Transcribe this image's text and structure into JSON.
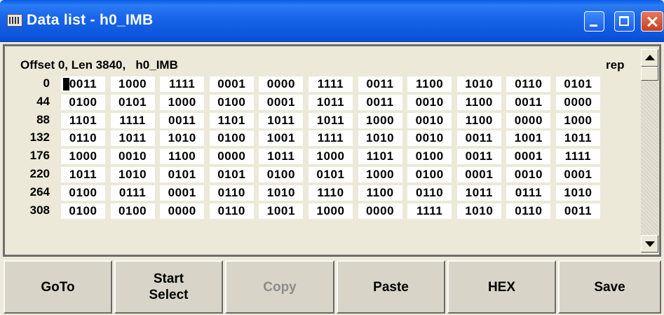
{
  "window": {
    "title": "Data list - h0_IMB"
  },
  "data_view": {
    "header": "Offset 0, Len 3840,   h0_IMB",
    "mode": "rep",
    "rows": [
      {
        "offset": "0",
        "cells": [
          "0011",
          "1000",
          "1111",
          "0001",
          "0000",
          "1111",
          "0011",
          "1100",
          "1010",
          "0110",
          "0101"
        ]
      },
      {
        "offset": "44",
        "cells": [
          "0100",
          "0101",
          "1000",
          "0100",
          "0001",
          "1011",
          "0011",
          "0010",
          "1100",
          "0011",
          "0000"
        ]
      },
      {
        "offset": "88",
        "cells": [
          "1101",
          "1111",
          "0011",
          "1101",
          "1011",
          "1011",
          "1000",
          "0010",
          "1100",
          "0000",
          "1000"
        ]
      },
      {
        "offset": "132",
        "cells": [
          "0110",
          "1011",
          "1010",
          "0100",
          "1001",
          "1111",
          "1010",
          "0010",
          "0011",
          "1001",
          "1011"
        ]
      },
      {
        "offset": "176",
        "cells": [
          "1000",
          "0010",
          "1100",
          "0000",
          "1011",
          "1000",
          "1101",
          "0100",
          "0011",
          "0001",
          "1111"
        ]
      },
      {
        "offset": "220",
        "cells": [
          "1011",
          "1010",
          "0101",
          "0101",
          "0100",
          "0101",
          "1000",
          "0100",
          "0001",
          "0010",
          "0001"
        ]
      },
      {
        "offset": "264",
        "cells": [
          "0100",
          "0111",
          "0001",
          "0110",
          "1010",
          "1110",
          "1100",
          "0110",
          "1011",
          "0111",
          "1010"
        ]
      },
      {
        "offset": "308",
        "cells": [
          "0100",
          "0100",
          "0000",
          "0110",
          "1001",
          "1000",
          "0000",
          "1111",
          "1010",
          "0110",
          "0011"
        ]
      }
    ]
  },
  "buttons": {
    "goto": "GoTo",
    "start_select_line1": "Start",
    "start_select_line2": "Select",
    "copy": "Copy",
    "paste": "Paste",
    "hex": "HEX",
    "save": "Save"
  },
  "colors": {
    "titlebar": "#0c55dc",
    "face": "#ece9d8",
    "disabled_text": "#8c8c8c"
  }
}
